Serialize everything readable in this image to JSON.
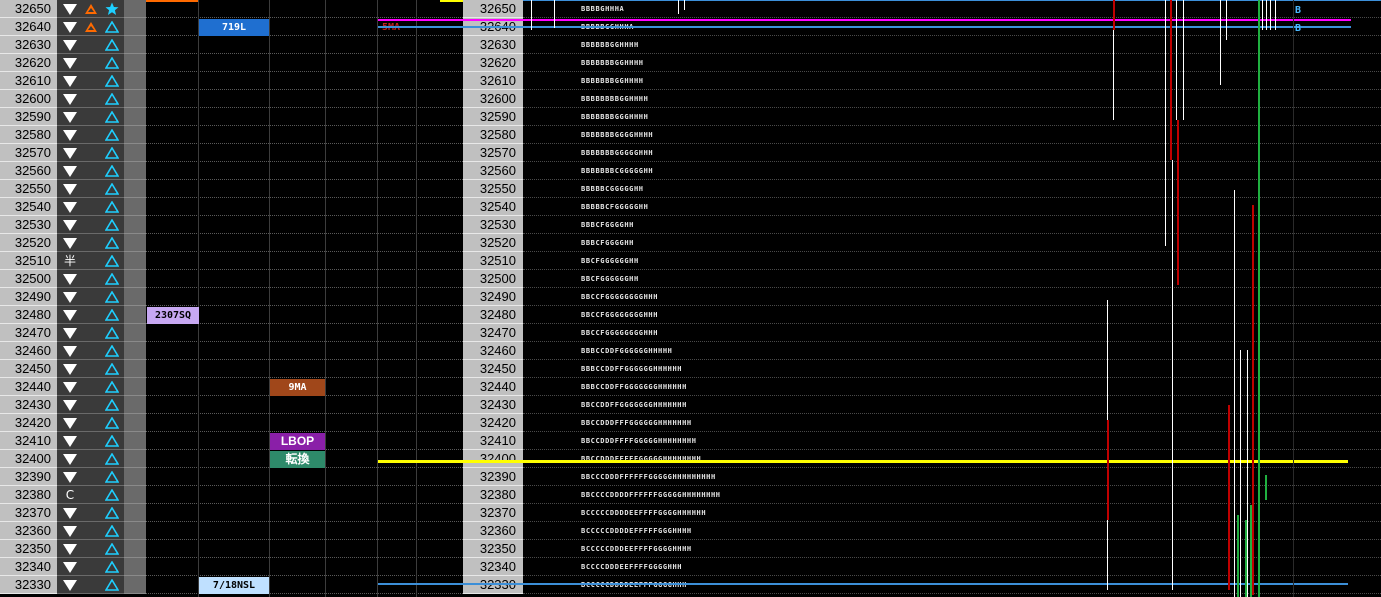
{
  "ladder": {
    "rows": [
      {
        "price": "32650",
        "a": "down",
        "b": "warn",
        "c": "star",
        "profile": "BBBBGHHHA"
      },
      {
        "price": "32640",
        "a": "down",
        "b": "warn",
        "c": "up",
        "profile": "BBBBBGGHHHA"
      },
      {
        "price": "32630",
        "a": "down",
        "b": "",
        "c": "up",
        "profile": "BBBBBBGGHHHH"
      },
      {
        "price": "32620",
        "a": "down",
        "b": "",
        "c": "up",
        "profile": "BBBBBBBGGHHHH"
      },
      {
        "price": "32610",
        "a": "down",
        "b": "",
        "c": "up",
        "profile": "BBBBBBBGGHHHH"
      },
      {
        "price": "32600",
        "a": "down",
        "b": "",
        "c": "up",
        "profile": "BBBBBBBBGGHHHH"
      },
      {
        "price": "32590",
        "a": "down",
        "b": "",
        "c": "up",
        "profile": "BBBBBBBGGGHHHH"
      },
      {
        "price": "32580",
        "a": "down",
        "b": "",
        "c": "up",
        "profile": "BBBBBBBGGGGHHHH"
      },
      {
        "price": "32570",
        "a": "down",
        "b": "",
        "c": "up",
        "profile": "BBBBBBBGGGGGHHH"
      },
      {
        "price": "32560",
        "a": "down",
        "b": "",
        "c": "up",
        "profile": "BBBBBBBCGGGGGHH"
      },
      {
        "price": "32550",
        "a": "down",
        "b": "",
        "c": "up",
        "profile": "BBBBBCGGGGGHH"
      },
      {
        "price": "32540",
        "a": "down",
        "b": "",
        "c": "up",
        "profile": "BBBBBCFGGGGGHH"
      },
      {
        "price": "32530",
        "a": "down",
        "b": "",
        "c": "up",
        "profile": "BBBCFGGGGHH"
      },
      {
        "price": "32520",
        "a": "down",
        "b": "",
        "c": "up",
        "profile": "BBBCFGGGGHH"
      },
      {
        "price": "32510",
        "a": "半",
        "b": "",
        "c": "up",
        "profile": "BBCFGGGGGGHH"
      },
      {
        "price": "32500",
        "a": "down",
        "b": "",
        "c": "up",
        "profile": "BBCFGGGGGGHH"
      },
      {
        "price": "32490",
        "a": "down",
        "b": "",
        "c": "up",
        "profile": "BBCCFGGGGGGGGHHH"
      },
      {
        "price": "32480",
        "a": "down",
        "b": "",
        "c": "up",
        "profile": "BBCCFGGGGGGGGHHH"
      },
      {
        "price": "32470",
        "a": "down",
        "b": "",
        "c": "up",
        "profile": "BBCCFGGGGGGGGHHH"
      },
      {
        "price": "32460",
        "a": "down",
        "b": "",
        "c": "up",
        "profile": "BBBCCDDFGGGGGGHHHHH"
      },
      {
        "price": "32450",
        "a": "down",
        "b": "",
        "c": "up",
        "profile": "BBBCCDDFFGGGGGGHHHHHH"
      },
      {
        "price": "32440",
        "a": "down",
        "b": "",
        "c": "up",
        "profile": "BBBCCDDFFGGGGGGGHHHHHH"
      },
      {
        "price": "32430",
        "a": "down",
        "b": "",
        "c": "up",
        "profile": "BBCCDDFFGGGGGGGHHHHHHH"
      },
      {
        "price": "32420",
        "a": "down",
        "b": "",
        "c": "up",
        "profile": "BBCCDDDFFFGGGGGGHHHHHHH"
      },
      {
        "price": "32410",
        "a": "down",
        "b": "",
        "c": "up",
        "profile": "BBCCDDDFFFFGGGGGHHHHHHHH"
      },
      {
        "price": "32400",
        "a": "down",
        "b": "",
        "c": "up",
        "profile": "BBCCDDDFFFFFGGGGGHHHHHHHH"
      },
      {
        "price": "32390",
        "a": "down",
        "b": "",
        "c": "up",
        "profile": "BBCCCDDDFFFFFFGGGGGHHHHHHHHH"
      },
      {
        "price": "32380",
        "a": "C",
        "b": "",
        "c": "up",
        "profile": "BBCCCCDDDDFFFFFFGGGGGHHHHHHHH"
      },
      {
        "price": "32370",
        "a": "down",
        "b": "",
        "c": "up",
        "profile": "BCCCCCDDDDEEFFFFGGGGHHHHHH"
      },
      {
        "price": "32360",
        "a": "down",
        "b": "",
        "c": "up",
        "profile": "BCCCCCDDDDEFFFFFGGGHHHH"
      },
      {
        "price": "32350",
        "a": "down",
        "b": "",
        "c": "up",
        "profile": "BCCCCCDDDEEFFFFGGGGHHHH"
      },
      {
        "price": "32340",
        "a": "down",
        "b": "",
        "c": "up",
        "profile": "BCCCCDDDEEFFFFGGGGHHH"
      },
      {
        "price": "32330",
        "a": "down",
        "b": "",
        "c": "up",
        "profile": "BCCCCCDDDDEEFFFGGGGHHH"
      }
    ]
  },
  "tags": {
    "t719l": "719L",
    "t5ma": "5MA",
    "t2307sq": "2307SQ",
    "t9ma": "9MA",
    "tlbop": "LBOP",
    "ttenkan": "転換",
    "t718nsl": "7/18NSL"
  },
  "markers": {
    "b1": "B",
    "b2": "B"
  },
  "colors": {
    "price_bg": "#c0c0c0",
    "magenta": "#ff00ff",
    "yellow": "#ffff00",
    "blue_line": "#3c8fd8",
    "tag_719l": "#1f6fd0",
    "tag_2307sq": "#c7a8f2",
    "tag_9ma": "#a0471a",
    "tag_lbop": "#8a1fa8",
    "tag_tenkan": "#2e8a6a",
    "tag_718nsl": "#bfe0ff"
  }
}
